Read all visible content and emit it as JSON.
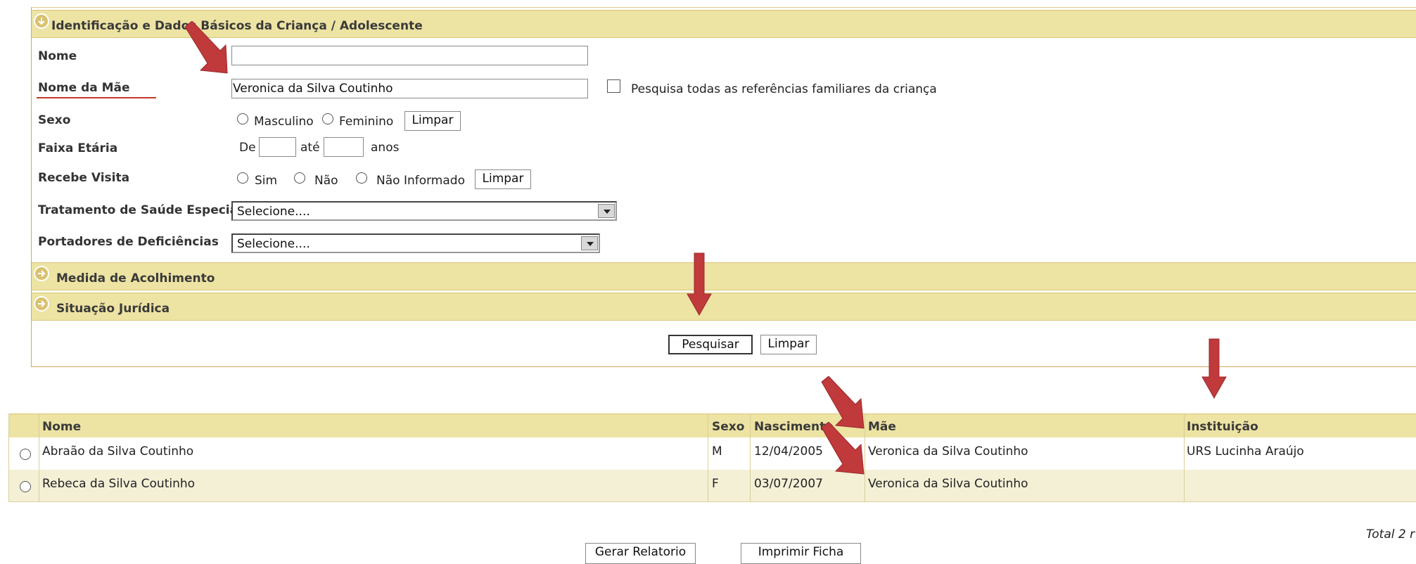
{
  "sections": {
    "identificacao": "Identificação e Dados Básicos da Criança / Adolescente",
    "medida": "Medida de Acolhimento",
    "situacao": "Situação Jurídica"
  },
  "form": {
    "nome_label": "Nome",
    "nome_value": "",
    "mae_label": "Nome da Mãe",
    "mae_value": "Veronica da Silva Coutinho",
    "pesquisa_familiares": "Pesquisa todas as referências familiares da criança",
    "sexo_label": "Sexo",
    "masculino": "Masculino",
    "feminino": "Feminino",
    "limpar": "Limpar",
    "faixa_label": "Faixa Etária",
    "de": "De",
    "ate": "até",
    "anos": "anos",
    "visita_label": "Recebe Visita",
    "sim": "Sim",
    "nao": "Não",
    "nao_informado": "Não Informado",
    "tratamento_label": "Tratamento de Saúde Especial",
    "tratamento_value": "Selecione....",
    "deficiencia_label": "Portadores de Deficiências",
    "deficiencia_value": "Selecione....",
    "pesquisar": "Pesquisar"
  },
  "table": {
    "headers": [
      "Nome",
      "Sexo",
      "Nascimento",
      "Mãe",
      "Instituição"
    ],
    "rows": [
      {
        "nome": "Abraão da Silva Coutinho",
        "sexo": "M",
        "nascimento": "12/04/2005",
        "mae": "Veronica da Silva Coutinho",
        "instituicao": "URS Lucinha Araújo"
      },
      {
        "nome": "Rebeca da Silva Coutinho",
        "sexo": "F",
        "nascimento": "03/07/2007",
        "mae": "Veronica da Silva Coutinho",
        "instituicao": ""
      }
    ],
    "total": "Total 2 r"
  },
  "footer": {
    "gerar": "Gerar Relatorio",
    "imprimir": "Imprimir Ficha"
  },
  "colors": {
    "section_bg": "#ede3a3",
    "row_alt": "#f4f0d6",
    "arrow": "#c0393b",
    "underline": "#c0392b"
  },
  "icons": [
    "circle-expand-icon",
    "arrow-pointer-icon"
  ]
}
